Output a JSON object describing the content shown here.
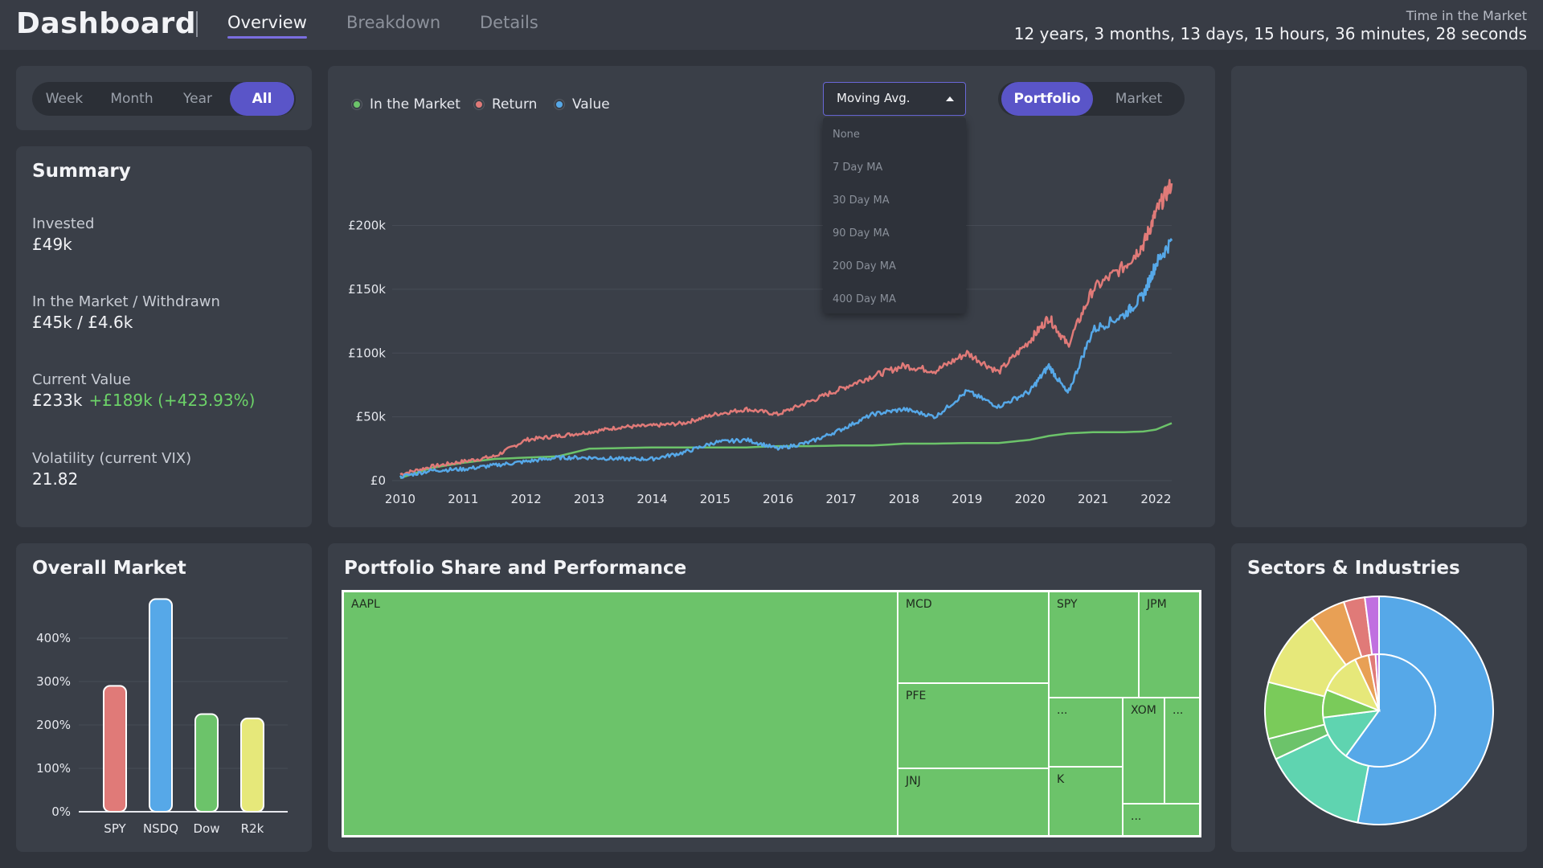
{
  "header": {
    "title": "Dashboard",
    "tabs": [
      {
        "label": "Overview",
        "active": true
      },
      {
        "label": "Breakdown",
        "active": false
      },
      {
        "label": "Details",
        "active": false
      }
    ],
    "time_in_market_label": "Time in the Market",
    "time_in_market_value": "12 years, 3 months, 13 days, 15 hours, 36 minutes, 28 seconds"
  },
  "range_toggle": {
    "options": [
      "Week",
      "Month",
      "Year",
      "All"
    ],
    "selected": "All"
  },
  "summary": {
    "title": "Summary",
    "invested_label": "Invested",
    "invested_value": "£49k",
    "market_label": "In the Market / Withdrawn",
    "market_value": "£45k / £4.6k",
    "current_label": "Current Value",
    "current_value": "£233k",
    "current_change": "+£189k (+423.93%)",
    "vix_label": "Volatility (current VIX)",
    "vix_value": "21.82"
  },
  "main_chart": {
    "legend": [
      {
        "label": "In the Market",
        "color": "#6cc36a"
      },
      {
        "label": "Return",
        "color": "#e07a78"
      },
      {
        "label": "Value",
        "color": "#56a8e8"
      }
    ],
    "moving_avg": {
      "label": "Moving Avg.",
      "options": [
        "None",
        "7 Day MA",
        "30 Day MA",
        "90 Day MA",
        "200 Day MA",
        "400 Day MA"
      ]
    },
    "view_toggle": {
      "options": [
        "Portfolio",
        "Market"
      ],
      "selected": "Portfolio"
    }
  },
  "overall_market": {
    "title": "Overall Market"
  },
  "portfolio_share": {
    "title": "Portfolio Share and Performance"
  },
  "sectors": {
    "title": "Sectors & Industries"
  },
  "colors": {
    "accent": "#5a55c8",
    "positive": "#6cd268",
    "return_line": "#e07a78",
    "value_line": "#56a8e8",
    "market_line": "#6cc36a"
  },
  "chart_data": [
    {
      "type": "line",
      "title": "",
      "x": [
        2010,
        2010.5,
        2011,
        2011.5,
        2012,
        2012.5,
        2013,
        2013.5,
        2014,
        2014.5,
        2015,
        2015.5,
        2016,
        2016.5,
        2017,
        2017.5,
        2018,
        2018.5,
        2019,
        2019.5,
        2020,
        2020.3,
        2020.6,
        2021,
        2021.5,
        2021.8,
        2022,
        2022.25
      ],
      "xticks": [
        "2010",
        "2011",
        "2012",
        "2013",
        "2014",
        "2015",
        "2016",
        "2017",
        "2018",
        "2019",
        "2020",
        "2021",
        "2022"
      ],
      "yticks": [
        "£0",
        "£50k",
        "£100k",
        "£150k",
        "£200k"
      ],
      "ylim": [
        0,
        240000
      ],
      "series": [
        {
          "name": "In the Market",
          "color": "#6cc36a",
          "values": [
            2000,
            10000,
            14000,
            17000,
            18000,
            19000,
            25000,
            25500,
            26000,
            26000,
            26000,
            26000,
            27000,
            27000,
            27500,
            27500,
            29000,
            29000,
            29500,
            29500,
            32000,
            35000,
            37000,
            38000,
            38000,
            38500,
            40000,
            45000
          ]
        },
        {
          "name": "Return",
          "color": "#e07a78",
          "values": [
            5000,
            11000,
            15000,
            19000,
            32000,
            35000,
            38000,
            42000,
            43000,
            45000,
            52000,
            56000,
            52000,
            62000,
            72000,
            82000,
            90000,
            86000,
            100000,
            85000,
            110000,
            128000,
            106000,
            150000,
            168000,
            185000,
            210000,
            233000
          ]
        },
        {
          "name": "Value",
          "color": "#56a8e8",
          "values": [
            3000,
            8000,
            9000,
            12000,
            15000,
            18000,
            18000,
            17000,
            17000,
            22000,
            30000,
            32000,
            25000,
            30000,
            40000,
            52000,
            56000,
            50000,
            70000,
            58000,
            70000,
            90000,
            68000,
            118000,
            130000,
            145000,
            170000,
            188000
          ]
        }
      ]
    },
    {
      "type": "bar",
      "title": "",
      "categories": [
        "SPY",
        "NSDQ",
        "Dow",
        "R2k"
      ],
      "values": [
        290,
        490,
        225,
        215
      ],
      "colors": [
        "#e07a78",
        "#56a8e8",
        "#6cc36a",
        "#e6e87a"
      ],
      "yticks": [
        "0%",
        "100%",
        "200%",
        "300%",
        "400%"
      ],
      "ylim": [
        0,
        500
      ]
    },
    {
      "type": "treemap",
      "title": "",
      "labels": [
        "AAPL",
        "MCD",
        "PFE",
        "JNJ",
        "SPY",
        "JPM",
        "...",
        "XOM",
        "...",
        "K",
        "..."
      ]
    },
    {
      "type": "pie",
      "title": "",
      "outer": [
        {
          "value": 53,
          "color": "#56a8e8"
        },
        {
          "value": 15,
          "color": "#5fd4b0"
        },
        {
          "value": 3,
          "color": "#6cc36a"
        },
        {
          "value": 8,
          "color": "#7acb5a"
        },
        {
          "value": 11,
          "color": "#e6e87a"
        },
        {
          "value": 5,
          "color": "#e8a055"
        },
        {
          "value": 3,
          "color": "#e07a78"
        },
        {
          "value": 2,
          "color": "#c070e0"
        }
      ],
      "inner": [
        {
          "value": 60,
          "color": "#56a8e8"
        },
        {
          "value": 13,
          "color": "#5fd4b0"
        },
        {
          "value": 8,
          "color": "#7acb5a"
        },
        {
          "value": 12,
          "color": "#e6e87a"
        },
        {
          "value": 4,
          "color": "#e8a055"
        },
        {
          "value": 2,
          "color": "#e07a78"
        },
        {
          "value": 1,
          "color": "#c070e0"
        }
      ]
    }
  ]
}
